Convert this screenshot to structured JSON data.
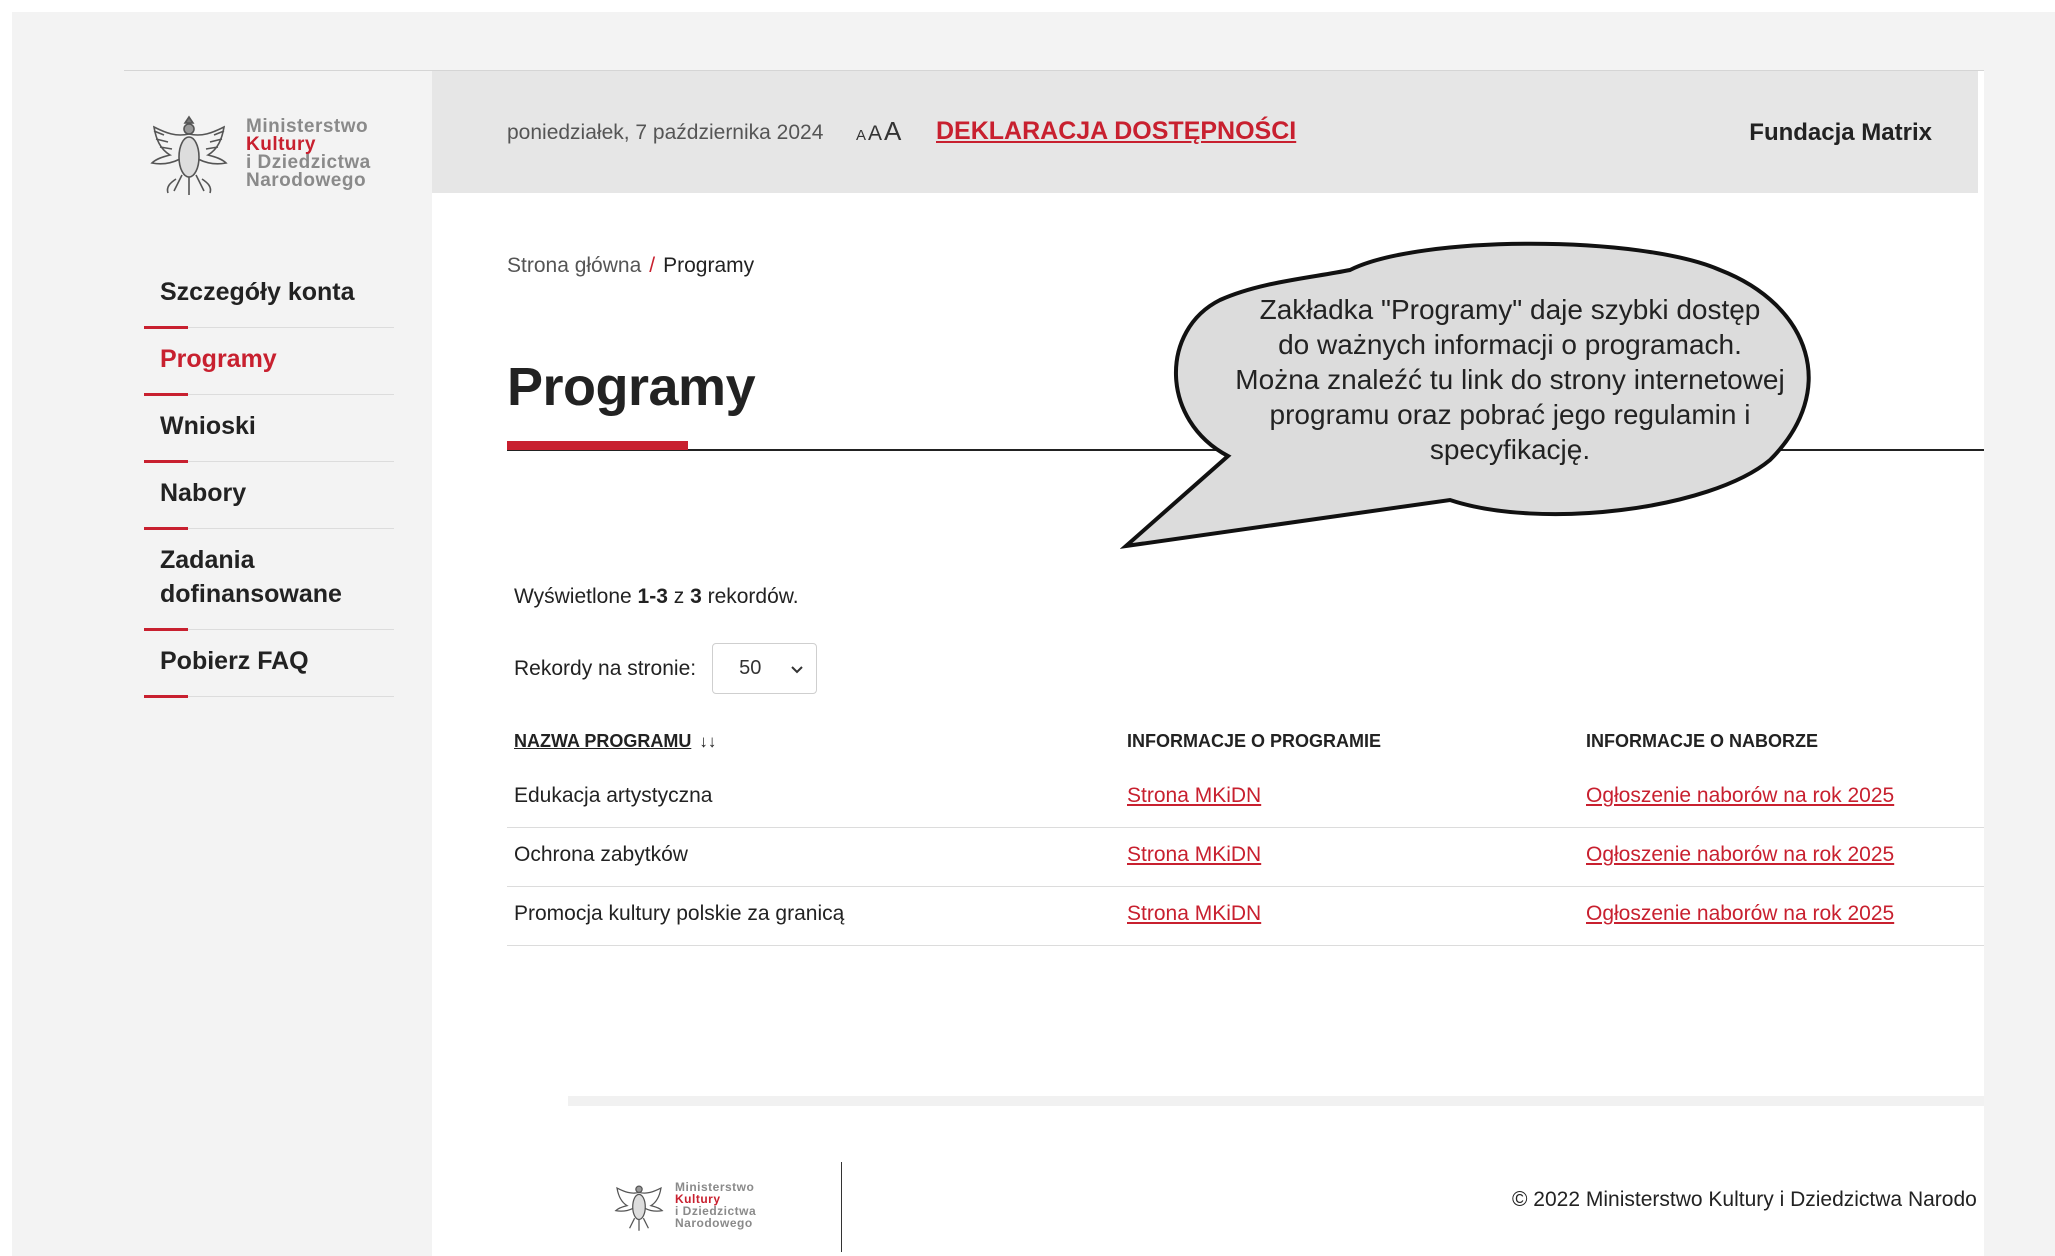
{
  "logo": {
    "line1": "Ministerstwo",
    "line2": "Kultury",
    "line3": "i Dziedzictwa",
    "line4": "Narodowego"
  },
  "nav": {
    "items": [
      {
        "label": "Szczegóły konta"
      },
      {
        "label": "Programy"
      },
      {
        "label": "Wnioski"
      },
      {
        "label": "Nabory"
      },
      {
        "label": "Zadania dofinansowane"
      },
      {
        "label": "Pobierz FAQ"
      }
    ]
  },
  "header": {
    "date": "poniedziałek, 7 października 2024",
    "font_small": "A",
    "font_medium": "A",
    "font_large": "A",
    "declaration": "DEKLARACJA DOSTĘPNOŚCI",
    "organization": "Fundacja Matrix"
  },
  "breadcrumb": {
    "home": "Strona główna",
    "separator": "/",
    "current": "Programy"
  },
  "page": {
    "title": "Programy",
    "records_prefix": "Wyświetlone ",
    "records_range": "1-3",
    "records_mid": " z ",
    "records_total": "3",
    "records_suffix": " rekordów.",
    "per_page_label": "Rekordy na stronie:",
    "per_page_value": "50"
  },
  "table": {
    "headers": [
      "NAZWA PROGRAMU",
      "INFORMACJE O PROGRAMIE",
      "INFORMACJE O NABORZE"
    ],
    "rows": [
      {
        "name": "Edukacja artystyczna",
        "info": "Strona MKiDN",
        "call": "Ogłoszenie naborów na rok 2025"
      },
      {
        "name": "Ochrona zabytków",
        "info": "Strona MKiDN",
        "call": "Ogłoszenie naborów na rok 2025"
      },
      {
        "name": "Promocja kultury polskie za granicą",
        "info": "Strona MKiDN",
        "call": "Ogłoszenie naborów na rok 2025"
      }
    ]
  },
  "callout": {
    "line1": "Zakładka \"Programy\" daje szybki dostęp",
    "line2": "do ważnych informacji o programach.",
    "line3": "Można znaleźć tu link do strony internetowej",
    "line4": "programu oraz pobrać jego regulamin i",
    "line5": "specyfikację."
  },
  "footer": {
    "copyright": "© 2022 Ministerstwo Kultury i Dziedzictwa Narodo"
  },
  "colors": {
    "accent": "#c8202f",
    "sidebar_bg": "#f3f3f3",
    "topbar_bg": "#e6e6e6"
  }
}
